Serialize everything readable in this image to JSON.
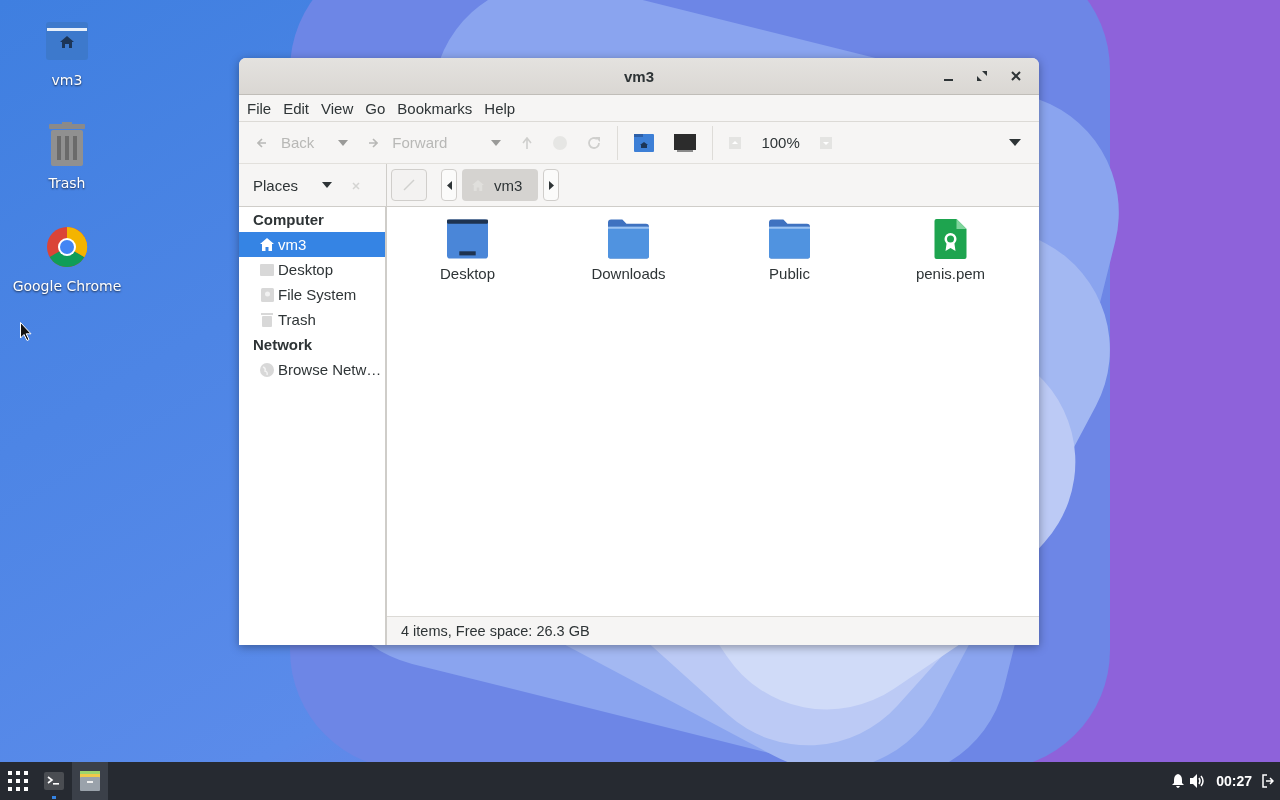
{
  "desktop_icons": [
    {
      "label": "vm3",
      "kind": "home"
    },
    {
      "label": "Trash",
      "kind": "trash"
    },
    {
      "label": "Google Chrome",
      "kind": "chrome"
    }
  ],
  "window": {
    "title": "vm3"
  },
  "menu": [
    "File",
    "Edit",
    "View",
    "Go",
    "Bookmarks",
    "Help"
  ],
  "toolbar": {
    "back": {
      "label": "Back",
      "disabled": true
    },
    "forward": {
      "label": "Forward",
      "disabled": true
    },
    "zoom": "100%"
  },
  "location": {
    "places_label": "Places",
    "path": [
      {
        "label": "vm3",
        "selected": true
      }
    ]
  },
  "sidebar": [
    {
      "heading": "Computer",
      "items": [
        {
          "label": "vm3",
          "kind": "home",
          "selected": true
        },
        {
          "label": "Desktop",
          "kind": "desktop",
          "selected": false
        },
        {
          "label": "File System",
          "kind": "drive",
          "selected": false
        },
        {
          "label": "Trash",
          "kind": "trash",
          "selected": false
        }
      ]
    },
    {
      "heading": "Network",
      "items": [
        {
          "label": "Browse Netw…",
          "kind": "network",
          "selected": false
        }
      ]
    }
  ],
  "files": [
    {
      "name": "Desktop",
      "kind": "desktop"
    },
    {
      "name": "Downloads",
      "kind": "folder"
    },
    {
      "name": "Public",
      "kind": "folder"
    },
    {
      "name": "penis.pem",
      "kind": "certificate"
    }
  ],
  "status": "4 items, Free space: 26.3 GB",
  "taskbar": {
    "apps": [
      {
        "kind": "terminal",
        "selected": false
      },
      {
        "kind": "files",
        "selected": true
      }
    ],
    "clock": "00:27"
  }
}
